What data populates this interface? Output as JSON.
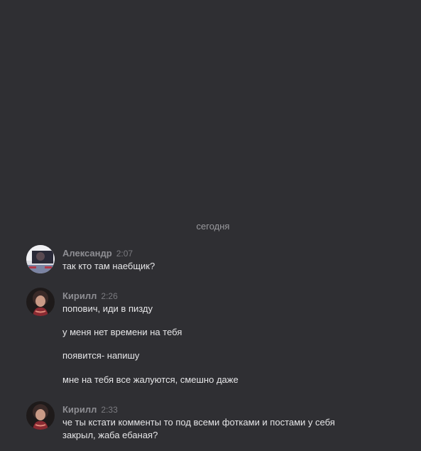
{
  "date_divider": "сегодня",
  "messages": [
    {
      "author": "Александр",
      "time": "2:07",
      "avatar": "user-avatar-alexander",
      "lines": [
        "так кто там наебщик?"
      ]
    },
    {
      "author": "Кирилл",
      "time": "2:26",
      "avatar": "user-avatar-kirill",
      "lines": [
        "попович, иди в пизду",
        "у меня нет времени на тебя",
        "появится- напишу",
        "мне на тебя все жалуются, смешно даже"
      ]
    },
    {
      "author": "Кирилл",
      "time": "2:33",
      "avatar": "user-avatar-kirill",
      "lines": [
        "че ты кстати комменты то под всеми фотками и постами у себя закрыл, жаба ебаная?"
      ]
    }
  ],
  "colors": {
    "background": "#2f2f33",
    "author": "#8e8e93",
    "text": "#e6e6e8",
    "muted": "#9a9a9e"
  }
}
